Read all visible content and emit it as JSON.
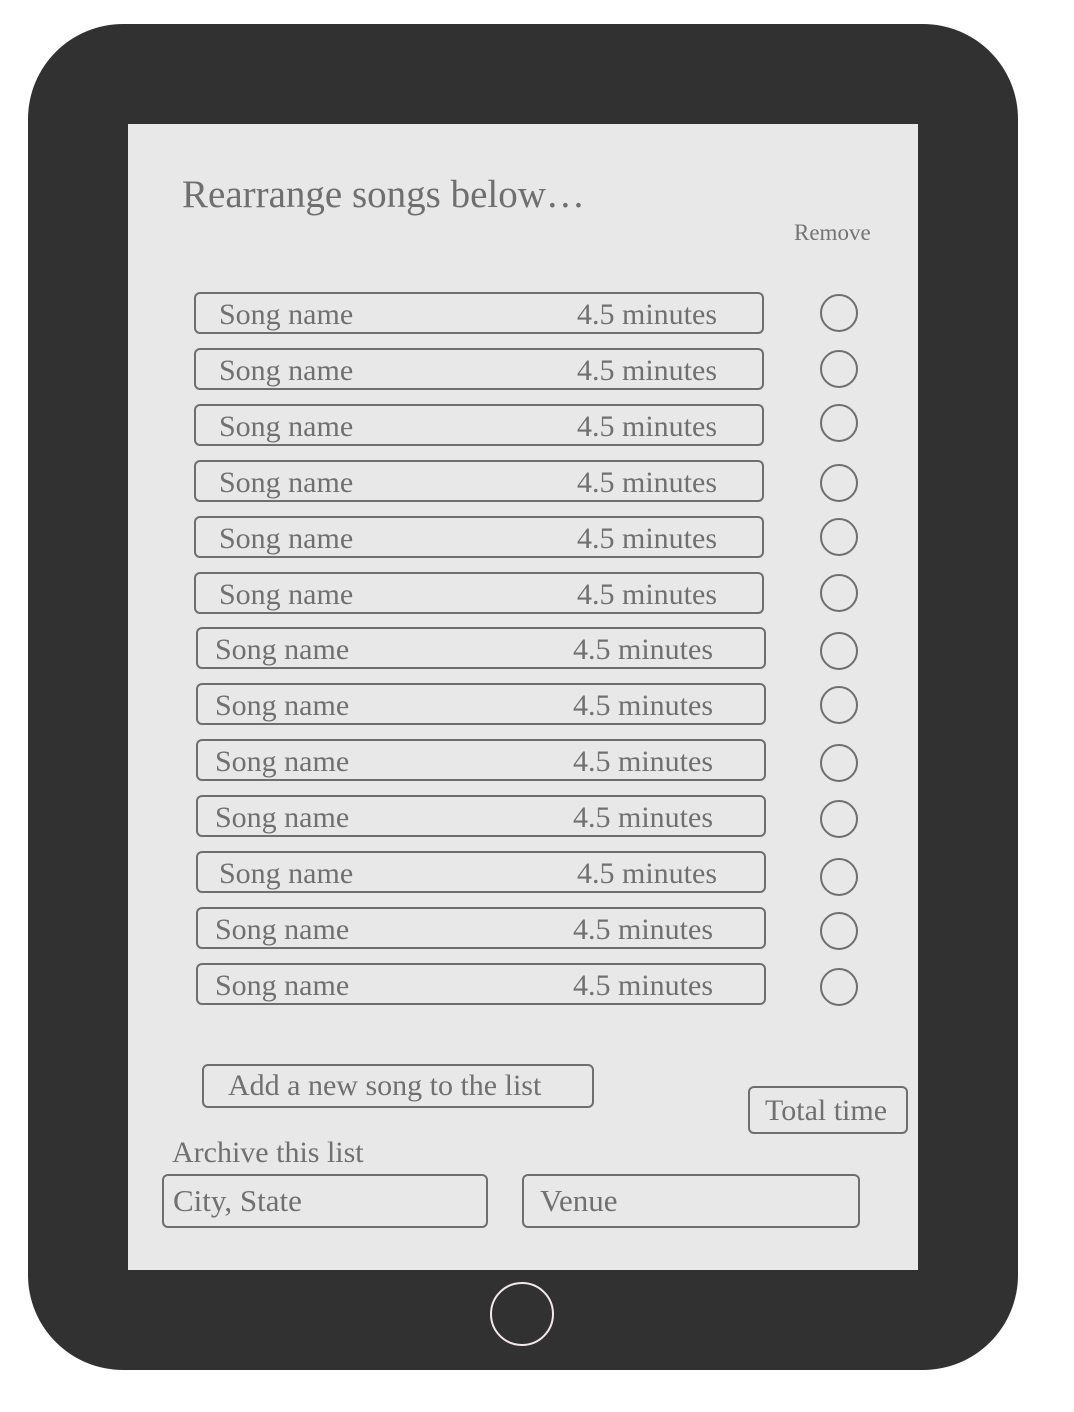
{
  "page": {
    "title": "Rearrange songs below…",
    "remove_header": "Remove"
  },
  "songs": [
    {
      "name": "Song name",
      "duration": "4.5 minutes"
    },
    {
      "name": "Song name",
      "duration": "4.5 minutes"
    },
    {
      "name": "Song name",
      "duration": "4.5 minutes"
    },
    {
      "name": "Song name",
      "duration": "4.5 minutes"
    },
    {
      "name": "Song name",
      "duration": "4.5 minutes"
    },
    {
      "name": "Song name",
      "duration": "4.5 minutes"
    },
    {
      "name": "Song name",
      "duration": "4.5 minutes"
    },
    {
      "name": "Song name",
      "duration": "4.5 minutes"
    },
    {
      "name": "Song name",
      "duration": "4.5 minutes"
    },
    {
      "name": "Song name",
      "duration": "4.5 minutes"
    },
    {
      "name": "Song name",
      "duration": "4.5 minutes"
    },
    {
      "name": "Song name",
      "duration": "4.5 minutes"
    },
    {
      "name": "Song name",
      "duration": "4.5 minutes"
    }
  ],
  "actions": {
    "add_song_label": "Add a new song to the list",
    "total_time_label": "Total time"
  },
  "archive": {
    "label": "Archive this list",
    "city_state_value": "City, State",
    "venue_value": "Venue"
  },
  "colors": {
    "device_frame": "#323132",
    "screen_background": "#e8e8e8",
    "outline": "#6e6e6e",
    "text": "#707070"
  }
}
